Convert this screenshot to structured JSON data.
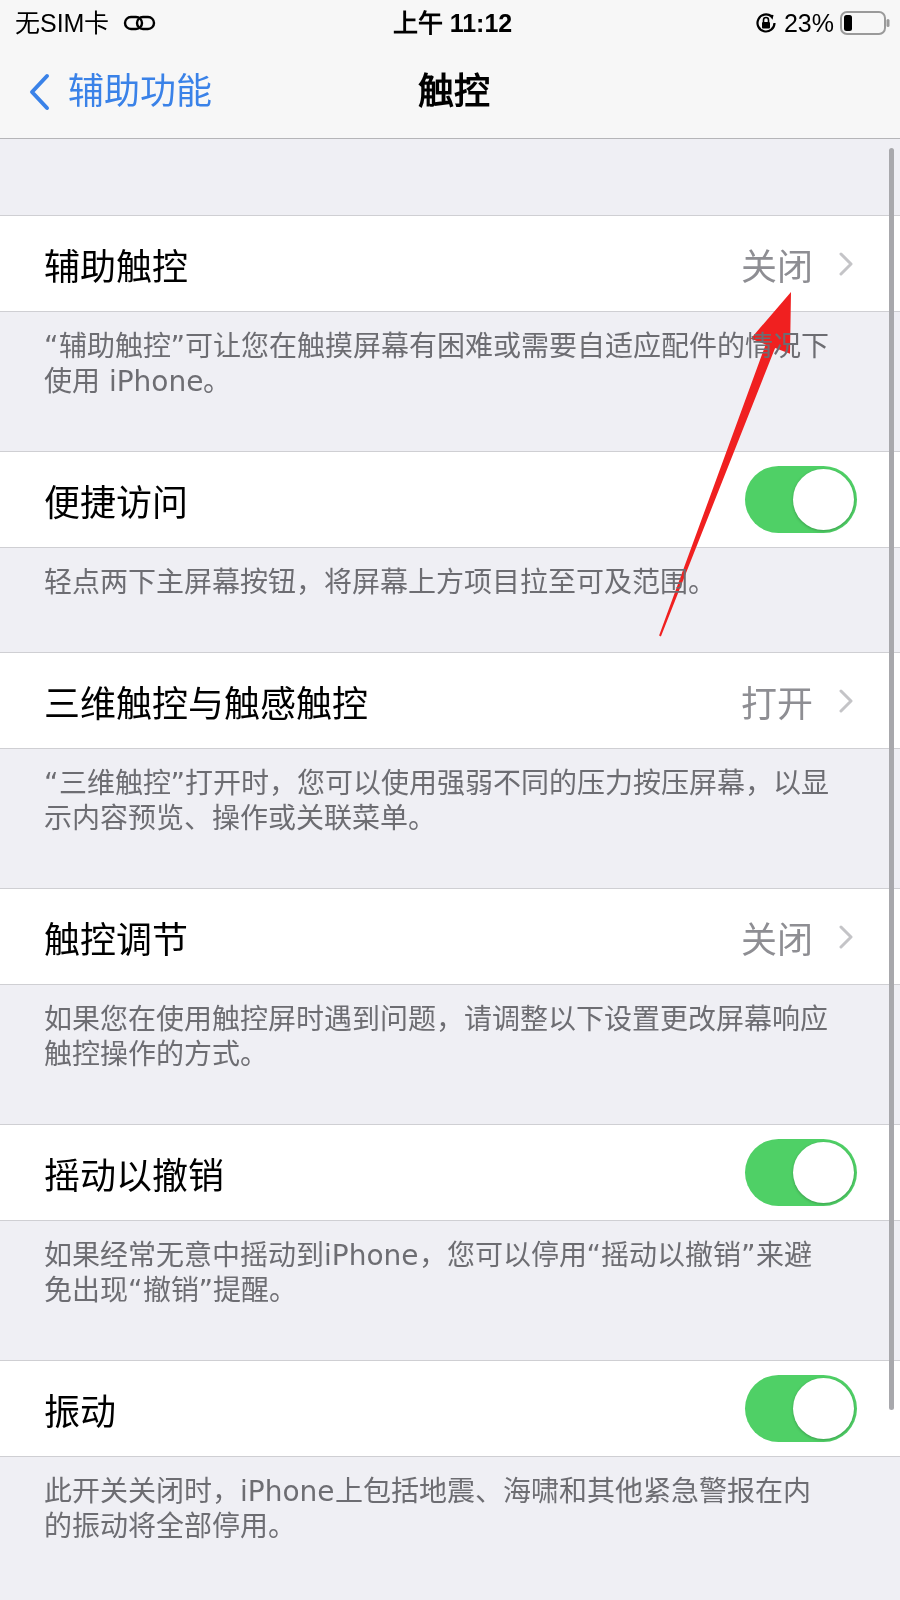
{
  "status_bar": {
    "carrier": "无SIM卡",
    "time": "上午 11:12",
    "battery": "23%"
  },
  "nav_bar": {
    "back_label": "辅助功能",
    "title": "触控"
  },
  "sections": [
    {
      "kind": "link",
      "label": "辅助触控",
      "value": "关闭",
      "footer": "“辅助触控”可让您在触摸屏幕有困难或需要自适应配件的情况下使用 iPhone。"
    },
    {
      "kind": "toggle",
      "label": "便捷访问",
      "on": true,
      "footer": "轻点两下主屏幕按钮，将屏幕上方项目拉至可及范围。"
    },
    {
      "kind": "link",
      "label": "三维触控与触感触控",
      "value": "打开",
      "footer": "“三维触控”打开时，您可以使用强弱不同的压力按压屏幕，以显示内容预览、操作或关联菜单。"
    },
    {
      "kind": "link",
      "label": "触控调节",
      "value": "关闭",
      "footer": "如果您在使用触控屏时遇到问题，请调整以下设置更改屏幕响应触控操作的方式。"
    },
    {
      "kind": "toggle",
      "label": "摇动以撤销",
      "on": true,
      "footer": "如果经常无意中摇动到iPhone，您可以停用“摇动以撤销”来避免出现“撤销”提醒。"
    },
    {
      "kind": "toggle",
      "label": "振动",
      "on": true,
      "footer": "此开关关闭时，iPhone上包括地震、海啸和其他紧急警报在内的振动将全部停用。"
    }
  ]
}
